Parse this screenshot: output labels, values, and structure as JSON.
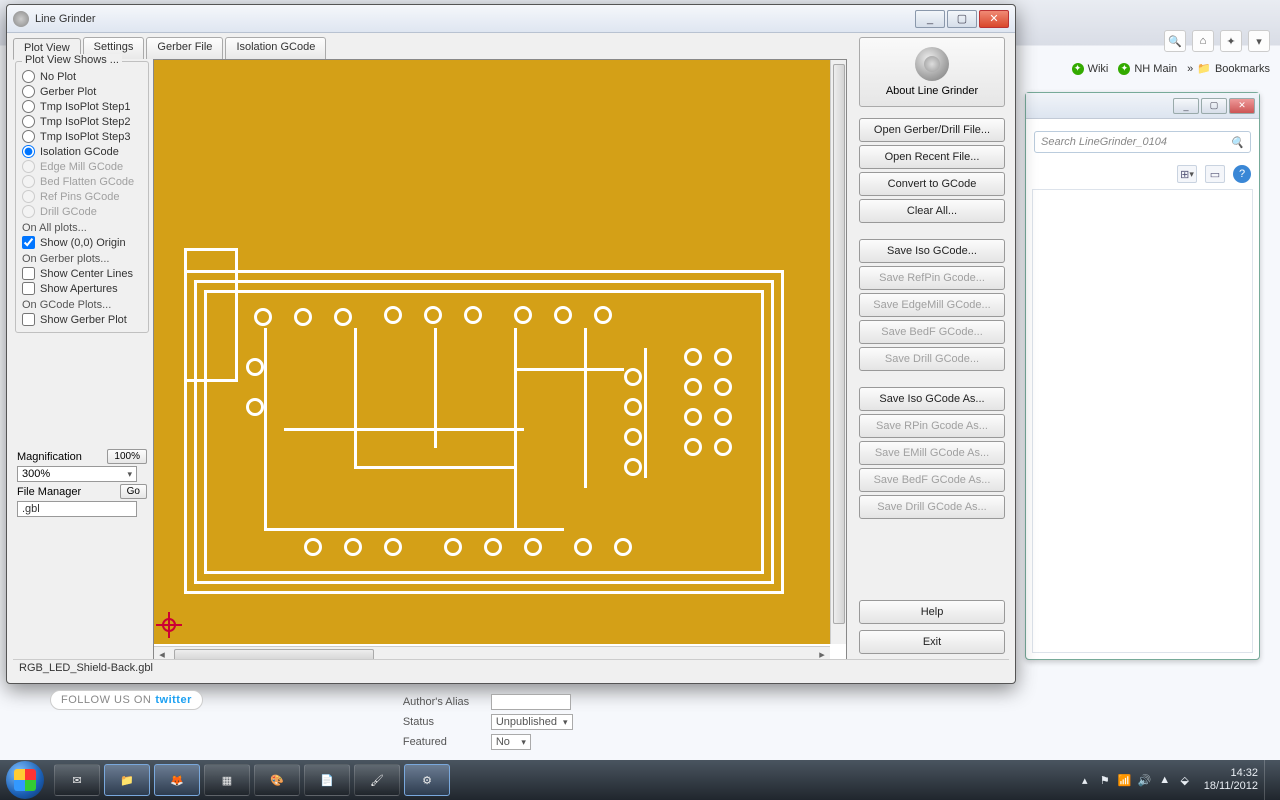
{
  "os_window": {
    "title": "Line Grinder",
    "min": "_",
    "max": "▢",
    "close": "✕"
  },
  "tabs": [
    "Plot View",
    "Settings",
    "Gerber File",
    "Isolation GCode"
  ],
  "plot_view": {
    "group": "Plot View Shows ...",
    "radios": [
      {
        "label": "No Plot",
        "checked": false,
        "enabled": true
      },
      {
        "label": "Gerber Plot",
        "checked": false,
        "enabled": true
      },
      {
        "label": "Tmp IsoPlot Step1",
        "checked": false,
        "enabled": true
      },
      {
        "label": "Tmp IsoPlot Step2",
        "checked": false,
        "enabled": true
      },
      {
        "label": "Tmp IsoPlot Step3",
        "checked": false,
        "enabled": true
      },
      {
        "label": "Isolation GCode",
        "checked": true,
        "enabled": true
      },
      {
        "label": "Edge Mill GCode",
        "checked": false,
        "enabled": false
      },
      {
        "label": "Bed Flatten GCode",
        "checked": false,
        "enabled": false
      },
      {
        "label": "Ref Pins GCode",
        "checked": false,
        "enabled": false
      },
      {
        "label": "Drill GCode",
        "checked": false,
        "enabled": false
      }
    ],
    "all_plots_label": "On All plots...",
    "show_origin": {
      "label": "Show (0,0) Origin",
      "checked": true
    },
    "gerber_plots_label": "On Gerber plots...",
    "show_center": {
      "label": "Show Center Lines",
      "checked": false
    },
    "show_apertures": {
      "label": "Show Apertures",
      "checked": false
    },
    "gcode_plots_label": "On GCode Plots...",
    "show_gerber_plot": {
      "label": "Show Gerber Plot",
      "checked": false
    }
  },
  "magnification": {
    "label": "Magnification",
    "reset_btn": "100%",
    "value": "300%"
  },
  "file_manager": {
    "label": "File Manager",
    "go_btn": "Go",
    "value": ".gbl"
  },
  "right_panel": {
    "about": "About Line Grinder",
    "buttons1": [
      {
        "label": "Open Gerber/Drill File...",
        "enabled": true
      },
      {
        "label": "Open Recent File...",
        "enabled": true
      },
      {
        "label": "Convert to GCode",
        "enabled": true
      },
      {
        "label": "Clear All...",
        "enabled": true
      }
    ],
    "buttons2": [
      {
        "label": "Save Iso GCode...",
        "enabled": true
      },
      {
        "label": "Save RefPin Gcode...",
        "enabled": false
      },
      {
        "label": "Save EdgeMill GCode...",
        "enabled": false
      },
      {
        "label": "Save BedF GCode...",
        "enabled": false
      },
      {
        "label": "Save Drill GCode...",
        "enabled": false
      }
    ],
    "buttons3": [
      {
        "label": "Save Iso GCode As...",
        "enabled": true
      },
      {
        "label": "Save RPin Gcode As...",
        "enabled": false
      },
      {
        "label": "Save EMill GCode As...",
        "enabled": false
      },
      {
        "label": "Save BedF GCode As...",
        "enabled": false
      },
      {
        "label": "Save Drill GCode As...",
        "enabled": false
      }
    ],
    "help": "Help",
    "exit": "Exit"
  },
  "status_bar": "RGB_LED_Shield-Back.gbl",
  "browser": {
    "bookmarks": {
      "wiki": "Wiki",
      "nhmain": "NH Main",
      "bookmarks": "Bookmarks"
    }
  },
  "explorer": {
    "search_placeholder": "Search LineGrinder_0104"
  },
  "page_behind": {
    "follow": "FOLLOW US ON",
    "twitter": "twitter",
    "alias_label": "Author's Alias",
    "status_label": "Status",
    "status_value": "Unpublished",
    "featured_label": "Featured",
    "featured_value": "No"
  },
  "taskbar": {
    "time": "14:32",
    "date": "18/11/2012"
  }
}
